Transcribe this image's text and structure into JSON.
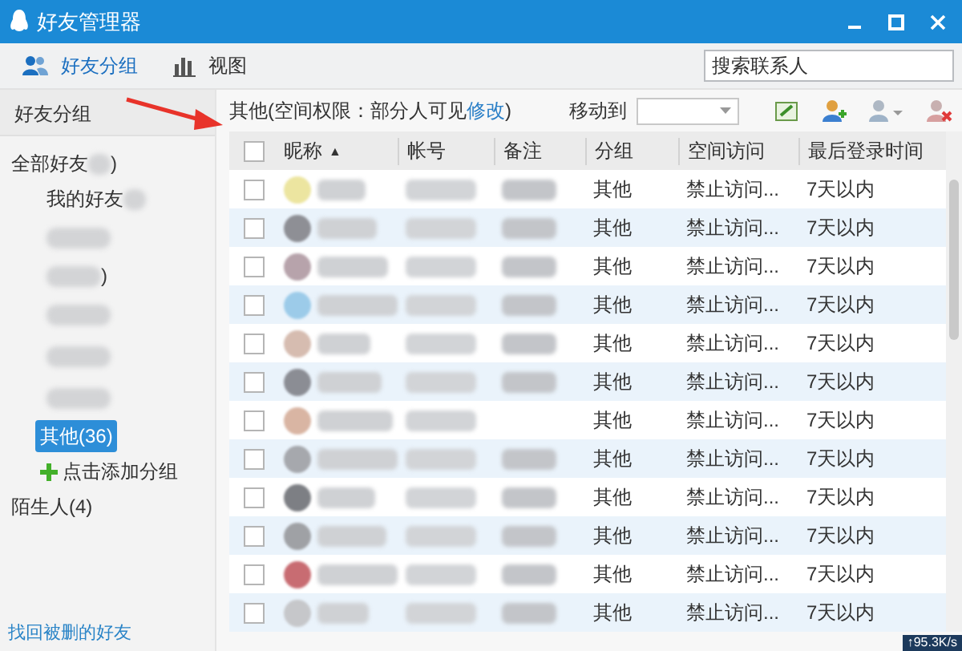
{
  "window": {
    "title": "好友管理器"
  },
  "tabs": [
    {
      "label": "好友分组",
      "selected": true
    },
    {
      "label": "视图",
      "selected": false
    }
  ],
  "search": {
    "placeholder": "搜索联系人"
  },
  "sidebar": {
    "title": "好友分组",
    "groups": [
      {
        "kind": "group",
        "label": "全部好友",
        "after": ")",
        "blurred": true,
        "selected": false,
        "children": [
          {
            "kind": "group",
            "label": "我的好友",
            "blurred": true,
            "selected": false
          },
          {
            "kind": "group",
            "blurred": true,
            "selected": false
          },
          {
            "kind": "group",
            "after": ")",
            "blurred": true,
            "selected": false
          },
          {
            "kind": "group",
            "blurred": true,
            "selected": false
          },
          {
            "kind": "group",
            "blurred": true,
            "selected": false
          },
          {
            "kind": "group",
            "blurred": true,
            "selected": false
          },
          {
            "kind": "group",
            "label": "其他(36)",
            "blurred": false,
            "selected": true
          },
          {
            "kind": "add",
            "label": "点击添加分组"
          }
        ]
      },
      {
        "kind": "group",
        "label": "陌生人(4)",
        "blurred": false,
        "selected": false
      }
    ],
    "footer_link": "找回被删的好友"
  },
  "table": {
    "caption": "其他(空间权限：部分人可见",
    "caption_link": "修改",
    "caption_end": ")",
    "move_label": "移动到",
    "select_all_checked": false,
    "columns": [
      {
        "label": "昵称",
        "sort": "▲"
      },
      {
        "label": "帐号"
      },
      {
        "label": "备注"
      },
      {
        "label": "分组"
      },
      {
        "label": "空间访问"
      },
      {
        "label": "最后登录时间"
      }
    ],
    "rows": [
      {
        "checked": false,
        "group": "其他",
        "access": "禁止访问...",
        "last_login": "7天以内"
      },
      {
        "checked": false,
        "group": "其他",
        "access": "禁止访问...",
        "last_login": "7天以内"
      },
      {
        "checked": false,
        "group": "其他",
        "access": "禁止访问...",
        "last_login": "7天以内"
      },
      {
        "checked": false,
        "group": "其他",
        "access": "禁止访问...",
        "last_login": "7天以内"
      },
      {
        "checked": false,
        "group": "其他",
        "access": "禁止访问...",
        "last_login": "7天以内"
      },
      {
        "checked": false,
        "group": "其他",
        "access": "禁止访问...",
        "last_login": "7天以内"
      },
      {
        "checked": false,
        "group": "其他",
        "access": "禁止访问...",
        "last_login": "7天以内"
      },
      {
        "checked": false,
        "group": "其他",
        "access": "禁止访问...",
        "last_login": "7天以内"
      },
      {
        "checked": false,
        "group": "其他",
        "access": "禁止访问...",
        "last_login": "7天以内"
      },
      {
        "checked": false,
        "group": "其他",
        "access": "禁止访问...",
        "last_login": "7天以内"
      },
      {
        "checked": false,
        "group": "其他",
        "access": "禁止访问...",
        "last_login": "7天以内"
      },
      {
        "checked": false,
        "group": "其他",
        "access": "禁止访问...",
        "last_login": "7天以内"
      }
    ]
  },
  "speed_badge": "↑95.3K/s"
}
